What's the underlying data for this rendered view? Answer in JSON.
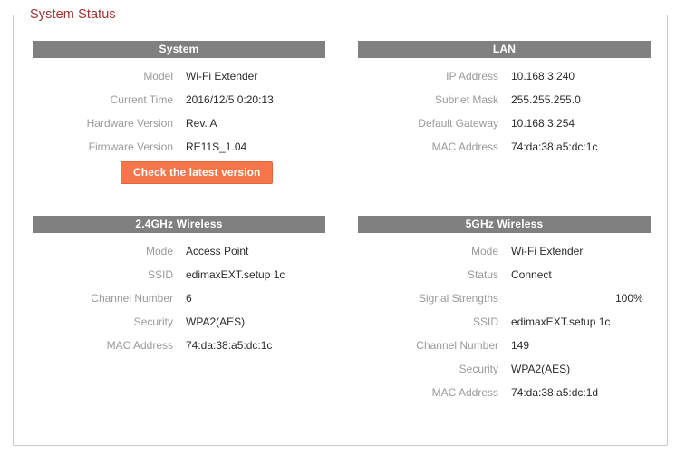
{
  "fieldset": {
    "legend": "System Status",
    "legend_color": "#a03030",
    "border_color": "#c9c9c9"
  },
  "theme": {
    "header_bg": "#808080",
    "header_text": "#ffffff",
    "label_color": "#9a9a9a",
    "value_color": "#2b2b2b",
    "button_bg": "#f4764a",
    "button_border": "#e0653b",
    "signal_bar_color": "#44c4f4"
  },
  "panels": {
    "system": {
      "title": "System",
      "rows": [
        {
          "label": "Model",
          "value": "Wi-Fi Extender"
        },
        {
          "label": "Current Time",
          "value": "2016/12/5  0:20:13"
        },
        {
          "label": "Hardware Version",
          "value": "Rev. A"
        },
        {
          "label": "Firmware Version",
          "value": "RE11S_1.04"
        }
      ],
      "button_label": "Check the latest version"
    },
    "lan": {
      "title": "LAN",
      "rows": [
        {
          "label": "IP Address",
          "value": "10.168.3.240"
        },
        {
          "label": "Subnet Mask",
          "value": "255.255.255.0"
        },
        {
          "label": "Default Gateway",
          "value": "10.168.3.254"
        },
        {
          "label": "MAC Address",
          "value": "74:da:38:a5:dc:1c"
        }
      ]
    },
    "wifi24": {
      "title": "2.4GHz  Wireless",
      "rows": [
        {
          "label": "Mode",
          "value": "Access Point"
        },
        {
          "label": "SSID",
          "value": "edimaxEXT.setup 1c"
        },
        {
          "label": "Channel Number",
          "value": "6"
        },
        {
          "label": "Security",
          "value": "WPA2(AES)"
        },
        {
          "label": "MAC Address",
          "value": "74:da:38:a5:dc:1c"
        }
      ]
    },
    "wifi5": {
      "title": "5GHz  Wireless",
      "rows": [
        {
          "label": "Mode",
          "value": "Wi-Fi Extender"
        },
        {
          "label": "Status",
          "value": "Connect"
        },
        {
          "label": "Signal Strengths",
          "value": "",
          "meter": {
            "percent": 100,
            "text": "100%"
          }
        },
        {
          "label": "SSID",
          "value": "edimaxEXT.setup 1c"
        },
        {
          "label": "Channel Number",
          "value": "149"
        },
        {
          "label": "Security",
          "value": "WPA2(AES)"
        },
        {
          "label": "MAC Address",
          "value": "74:da:38:a5:dc:1d"
        }
      ]
    }
  }
}
